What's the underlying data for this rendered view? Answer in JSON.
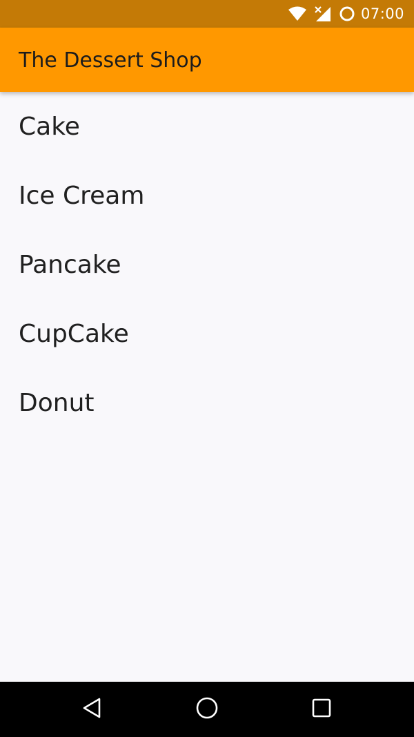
{
  "status_bar": {
    "time": "07:00",
    "icons": [
      "wifi-icon",
      "signal-icon",
      "battery-icon"
    ]
  },
  "app_bar": {
    "title": "The Dessert Shop",
    "color": "#ff9800"
  },
  "list": {
    "items": [
      {
        "label": "Cake"
      },
      {
        "label": "Ice Cream"
      },
      {
        "label": "Pancake"
      },
      {
        "label": "CupCake"
      },
      {
        "label": "Donut"
      }
    ]
  },
  "nav_bar": {
    "buttons": [
      "back-icon",
      "home-icon",
      "recents-icon"
    ]
  }
}
